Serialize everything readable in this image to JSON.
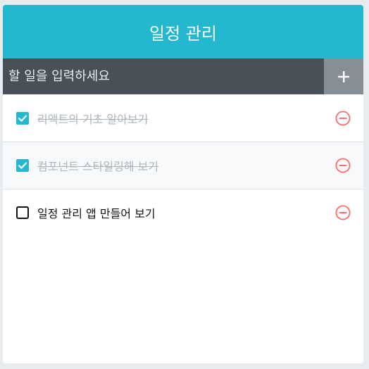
{
  "app": {
    "title": "일정 관리"
  },
  "insert": {
    "placeholder": "할 일을 입력하세요",
    "add_symbol": "+"
  },
  "todos": [
    {
      "text": "리액트의 기초 알아보기",
      "checked": true
    },
    {
      "text": "컴포넌트 스타일링해 보기",
      "checked": true
    },
    {
      "text": "일정 관리 앱 만들어 보기",
      "checked": false
    }
  ],
  "colors": {
    "accent": "#22b8cf",
    "input_bar": "#495057",
    "add_button": "#868e96",
    "remove": "#ff6b6b",
    "done_text": "#adb5bd"
  },
  "icons": {
    "checked": "checkbox-checked-icon",
    "unchecked": "checkbox-blank-icon",
    "remove": "remove-circle-icon",
    "add": "plus-icon"
  }
}
